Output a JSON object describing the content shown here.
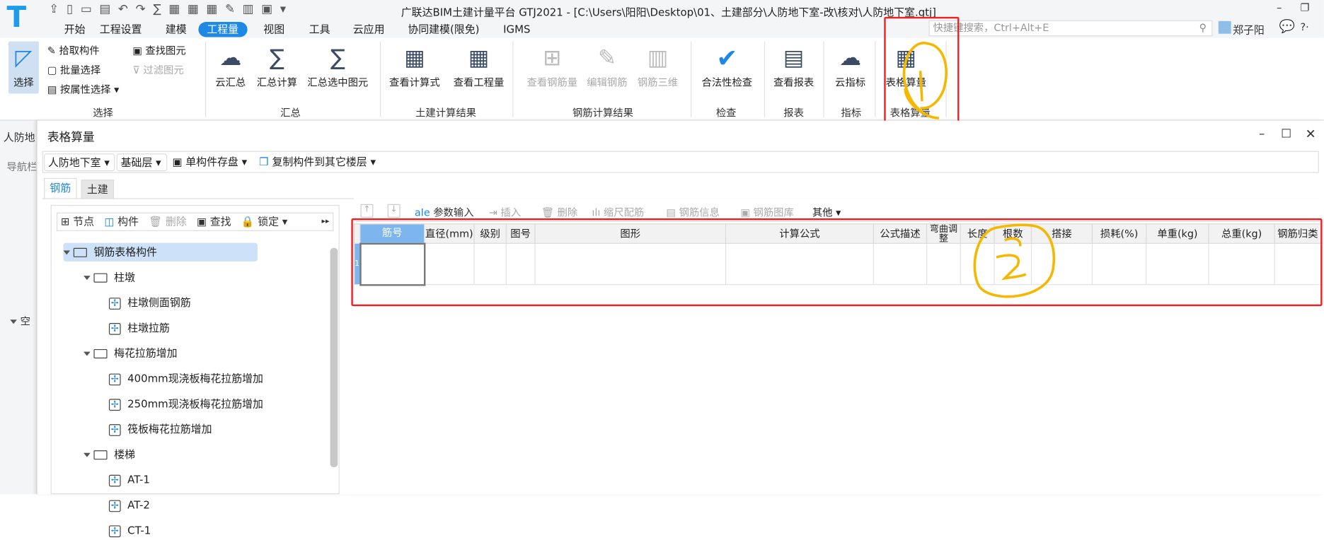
{
  "app": {
    "title": "广联达BIM土建计量平台 GTJ2021 - [C:\\Users\\阳阳\\Desktop\\01、土建部分\\人防地下室-改\\核对\\人防地下室.gtj]",
    "search_placeholder": "快捷键搜索，Ctrl+Alt+E",
    "user": "郑子阳",
    "help": "?·"
  },
  "menu": [
    "开始",
    "工程设置",
    "建模",
    "工程量",
    "视图",
    "工具",
    "云应用",
    "协同建模(限免)",
    "IGMS"
  ],
  "menu_active": "工程量",
  "ribbon": {
    "select": {
      "big": "选择",
      "items": [
        "拾取构件",
        "批量选择",
        "按属性选择",
        "查找图元",
        "过滤图元"
      ],
      "label": "选择"
    },
    "summary": {
      "items": [
        "云汇总",
        "汇总计算",
        "汇总选中图元"
      ],
      "label": "汇总"
    },
    "civil": {
      "items": [
        "查看计算式",
        "查看工程量"
      ],
      "label": "土建计算结果"
    },
    "rebar": {
      "items": [
        "查看钢筋量",
        "编辑钢筋",
        "钢筋三维"
      ],
      "label": "钢筋计算结果"
    },
    "check": {
      "items": [
        "合法性检查"
      ],
      "label": "检查"
    },
    "report": {
      "items": [
        "查看报表"
      ],
      "label": "报表"
    },
    "index": {
      "items": [
        "云指标"
      ],
      "label": "指标"
    },
    "table": {
      "items": [
        "表格算量"
      ],
      "label": "表格算量"
    }
  },
  "background": {
    "floor": "人防地",
    "nav": "导航栏",
    "node": "空"
  },
  "dialog": {
    "title": "表格算量",
    "floor": "人防地下室",
    "layer": "基础层",
    "save": "单构件存盘",
    "copy": "复制构件到其它楼层",
    "tabs": [
      "钢筋",
      "土建"
    ],
    "active_tab": "钢筋",
    "tree_toolbar": [
      "节点",
      "构件",
      "删除",
      "查找",
      "锁定"
    ],
    "tree": [
      {
        "label": "钢筋表格构件",
        "level": 0,
        "type": "folder",
        "selected": true
      },
      {
        "label": "柱墩",
        "level": 1,
        "type": "folder"
      },
      {
        "label": "柱墩侧面钢筋",
        "level": 2,
        "type": "component"
      },
      {
        "label": "柱墩拉筋",
        "level": 2,
        "type": "component"
      },
      {
        "label": "梅花拉筋增加",
        "level": 1,
        "type": "folder"
      },
      {
        "label": "400mm现浇板梅花拉筋增加",
        "level": 2,
        "type": "component"
      },
      {
        "label": "250mm现浇板梅花拉筋增加",
        "level": 2,
        "type": "component"
      },
      {
        "label": "筏板梅花拉筋增加",
        "level": 2,
        "type": "component"
      },
      {
        "label": "楼梯",
        "level": 1,
        "type": "folder"
      },
      {
        "label": "AT-1",
        "level": 2,
        "type": "component"
      },
      {
        "label": "AT-2",
        "level": 2,
        "type": "component"
      },
      {
        "label": "CT-1",
        "level": 2,
        "type": "component"
      }
    ],
    "grid_toolbar": [
      "参数输入",
      "插入",
      "删除",
      "缩尺配筋",
      "钢筋信息",
      "钢筋图库",
      "其他"
    ],
    "columns": [
      "筋号",
      "直径(mm)",
      "级别",
      "图号",
      "图形",
      "计算公式",
      "公式描述",
      "弯曲调整",
      "长度",
      "根数",
      "搭接",
      "损耗(%)",
      "单重(kg)",
      "总重(kg)",
      "钢筋归类"
    ],
    "rows": [
      {
        "num": "1"
      }
    ]
  },
  "annotations": [
    "1",
    "2"
  ],
  "colors": {
    "accent": "#1e88e5",
    "highlight": "#f01e1e",
    "annotation": "#f5b800"
  }
}
